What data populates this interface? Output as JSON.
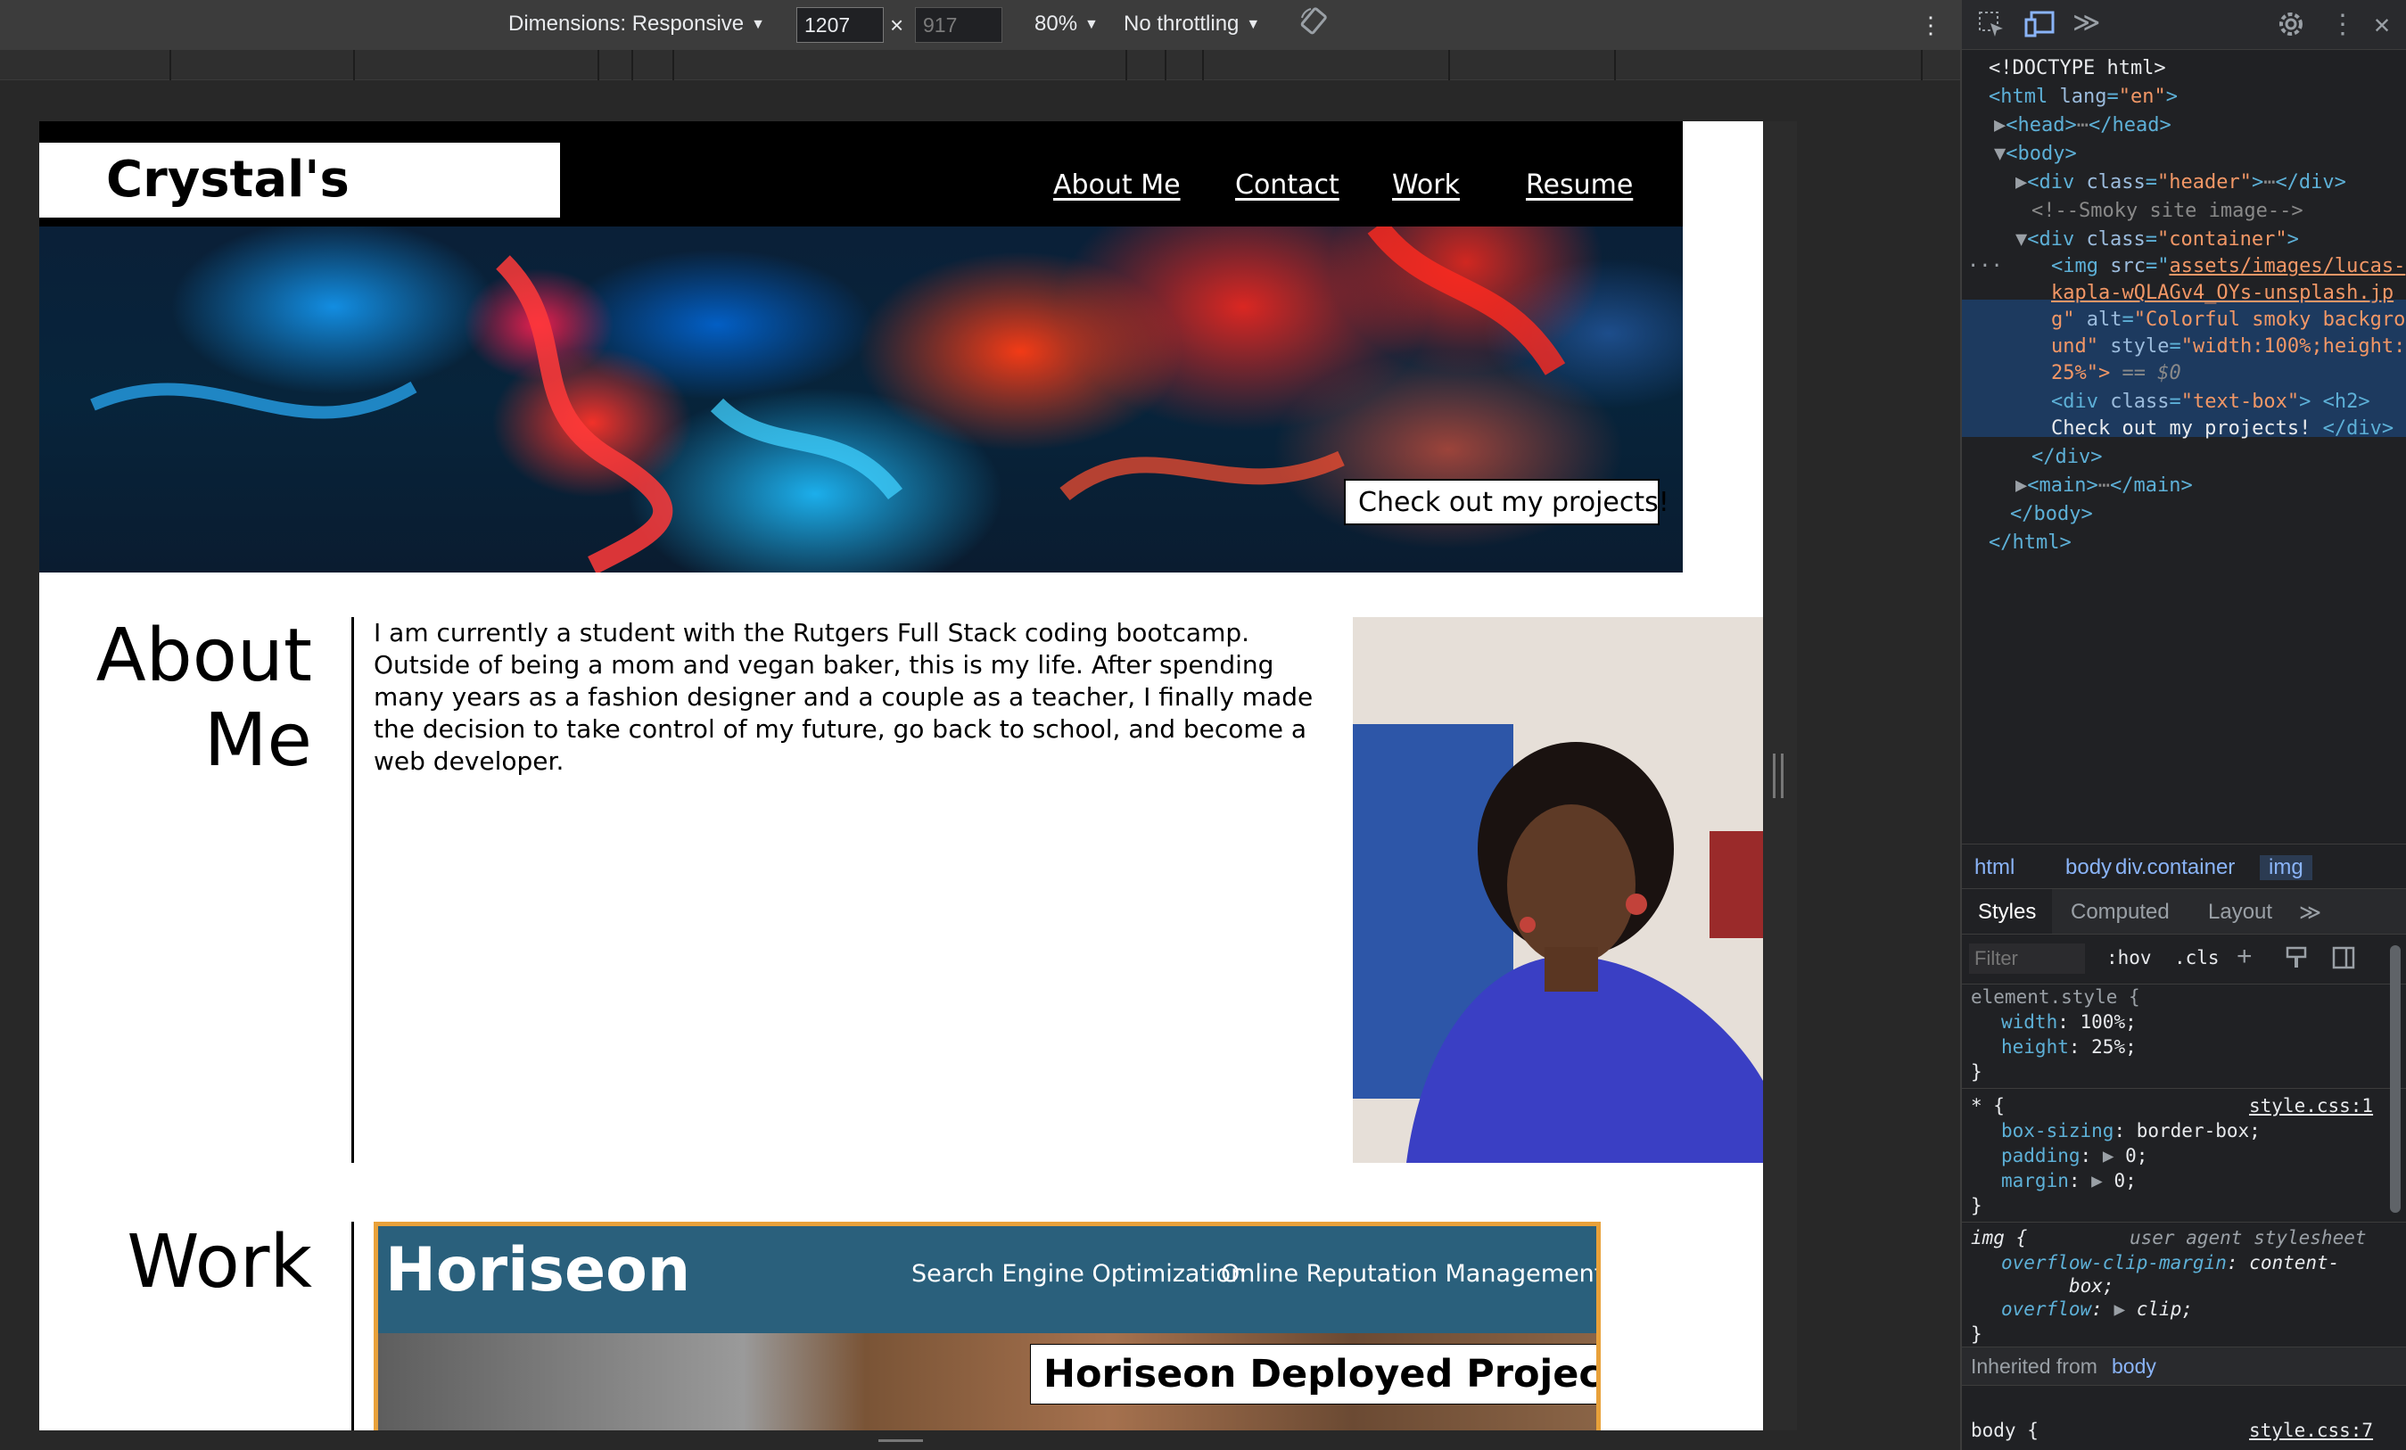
{
  "device_toolbar": {
    "dimensions_label": "Dimensions: Responsive",
    "width_value": "1207",
    "height_value": "917",
    "times": "×",
    "zoom": "80%",
    "throttling": "No throttling",
    "more": "⋮"
  },
  "site": {
    "title": "Crystal's Portfolio",
    "nav": [
      "About Me",
      "Contact",
      "Work",
      "Resume"
    ],
    "hero_text": "Check out my projects!",
    "about": {
      "heading_line1": "About",
      "heading_line2": "Me",
      "text": "I am currently a student with the Rutgers Full Stack coding bootcamp. Outside of being a mom and vegan baker, this is my life. After spending many years as a fashion designer and a couple as a teacher, I finally made the decision to take control of my future, go back to school, and become a web developer."
    },
    "work": {
      "heading": "Work",
      "project": {
        "logo": "Horiseon",
        "nav": [
          "Search Engine Optimization",
          "Online Reputation Management"
        ],
        "label": "Horiseon Deployed Project"
      }
    }
  },
  "devtools": {
    "toolbar_icons": [
      "inspect-icon",
      "device-toggle-icon",
      "more-panels-icon",
      "settings-icon",
      "kebab-icon",
      "close-icon"
    ],
    "dom": {
      "doctype": "<!DOCTYPE html>",
      "html_open_tag": "<html",
      "lang_attr": "lang",
      "lang_val": "\"en\"",
      "head": "<head>",
      "head_close": "</head>",
      "body": "<body>",
      "div_header_open": "<div",
      "class_attr": "class",
      "header_val": "\"header\"",
      "div_close": "</div>",
      "comment": "<!--Smoky site image-->",
      "container_val": "\"container\"",
      "img_open": "<img",
      "src_attr": "src",
      "src_val_1": "assets/images/lucas-",
      "src_val_2": "kapla-wQLAGv4_OYs-unsplash.jp",
      "src_val_3": "g\"",
      "alt_attr": "alt",
      "alt_val_1": "\"Colorful smoky backgro",
      "alt_val_2": "und\"",
      "style_attr": "style",
      "style_val_1": "\"width:100%;height:",
      "style_val_2": "25%\">",
      "eq_sel": "== $0",
      "text_box_val": "\"text-box\"",
      "h2_tag": "<h2>",
      "textbox_text": "Check out my projects!",
      "main_open": "<main>",
      "main_close": "</main>",
      "body_close": "</body>",
      "html_close": "</html>",
      "ellipsis": "⋯",
      "dots": "···"
    },
    "breadcrumbs": [
      "html",
      "body",
      "div.container",
      "img"
    ],
    "styles_tabs": [
      "Styles",
      "Computed",
      "Layout",
      "≫"
    ],
    "filter_placeholder": "Filter",
    "hov": ":hov",
    "cls": ".cls",
    "rules": {
      "element_selector": "element.style {",
      "element_props": [
        [
          "width",
          "100%;"
        ],
        [
          "height",
          "25%;"
        ]
      ],
      "close_brace": "}",
      "star_selector": "* {",
      "star_source": "style.css:1",
      "star_props": [
        [
          "box-sizing",
          "border-box;"
        ],
        [
          "padding",
          "0;"
        ],
        [
          "margin",
          "0;"
        ]
      ],
      "img_selector": "img {",
      "img_source": "user agent stylesheet",
      "img_props": [
        [
          "overflow-clip-margin",
          "content-"
        ],
        [
          "overflow",
          "clip;"
        ]
      ],
      "img_prop_cont": "box;",
      "inherited_label": "Inherited from",
      "inherited_from": "body",
      "body_selector": "body {",
      "body_source": "style.css:7"
    }
  }
}
